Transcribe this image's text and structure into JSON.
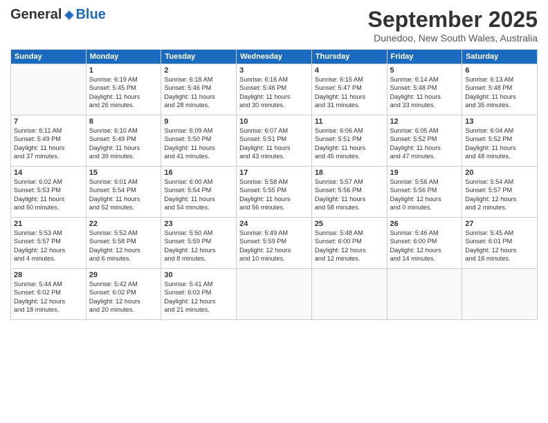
{
  "logo": {
    "general": "General",
    "blue": "Blue"
  },
  "header": {
    "month": "September 2025",
    "location": "Dunedoo, New South Wales, Australia"
  },
  "weekdays": [
    "Sunday",
    "Monday",
    "Tuesday",
    "Wednesday",
    "Thursday",
    "Friday",
    "Saturday"
  ],
  "weeks": [
    [
      {
        "day": "",
        "info": ""
      },
      {
        "day": "1",
        "info": "Sunrise: 6:19 AM\nSunset: 5:45 PM\nDaylight: 11 hours\nand 26 minutes."
      },
      {
        "day": "2",
        "info": "Sunrise: 6:18 AM\nSunset: 5:46 PM\nDaylight: 11 hours\nand 28 minutes."
      },
      {
        "day": "3",
        "info": "Sunrise: 6:16 AM\nSunset: 5:46 PM\nDaylight: 11 hours\nand 30 minutes."
      },
      {
        "day": "4",
        "info": "Sunrise: 6:15 AM\nSunset: 5:47 PM\nDaylight: 11 hours\nand 31 minutes."
      },
      {
        "day": "5",
        "info": "Sunrise: 6:14 AM\nSunset: 5:48 PM\nDaylight: 11 hours\nand 33 minutes."
      },
      {
        "day": "6",
        "info": "Sunrise: 6:13 AM\nSunset: 5:48 PM\nDaylight: 11 hours\nand 35 minutes."
      }
    ],
    [
      {
        "day": "7",
        "info": "Sunrise: 6:11 AM\nSunset: 5:49 PM\nDaylight: 11 hours\nand 37 minutes."
      },
      {
        "day": "8",
        "info": "Sunrise: 6:10 AM\nSunset: 5:49 PM\nDaylight: 11 hours\nand 39 minutes."
      },
      {
        "day": "9",
        "info": "Sunrise: 6:09 AM\nSunset: 5:50 PM\nDaylight: 11 hours\nand 41 minutes."
      },
      {
        "day": "10",
        "info": "Sunrise: 6:07 AM\nSunset: 5:51 PM\nDaylight: 11 hours\nand 43 minutes."
      },
      {
        "day": "11",
        "info": "Sunrise: 6:06 AM\nSunset: 5:51 PM\nDaylight: 11 hours\nand 45 minutes."
      },
      {
        "day": "12",
        "info": "Sunrise: 6:05 AM\nSunset: 5:52 PM\nDaylight: 11 hours\nand 47 minutes."
      },
      {
        "day": "13",
        "info": "Sunrise: 6:04 AM\nSunset: 5:52 PM\nDaylight: 11 hours\nand 48 minutes."
      }
    ],
    [
      {
        "day": "14",
        "info": "Sunrise: 6:02 AM\nSunset: 5:53 PM\nDaylight: 11 hours\nand 50 minutes."
      },
      {
        "day": "15",
        "info": "Sunrise: 6:01 AM\nSunset: 5:54 PM\nDaylight: 11 hours\nand 52 minutes."
      },
      {
        "day": "16",
        "info": "Sunrise: 6:00 AM\nSunset: 5:54 PM\nDaylight: 11 hours\nand 54 minutes."
      },
      {
        "day": "17",
        "info": "Sunrise: 5:58 AM\nSunset: 5:55 PM\nDaylight: 11 hours\nand 56 minutes."
      },
      {
        "day": "18",
        "info": "Sunrise: 5:57 AM\nSunset: 5:56 PM\nDaylight: 11 hours\nand 58 minutes."
      },
      {
        "day": "19",
        "info": "Sunrise: 5:56 AM\nSunset: 5:56 PM\nDaylight: 12 hours\nand 0 minutes."
      },
      {
        "day": "20",
        "info": "Sunrise: 5:54 AM\nSunset: 5:57 PM\nDaylight: 12 hours\nand 2 minutes."
      }
    ],
    [
      {
        "day": "21",
        "info": "Sunrise: 5:53 AM\nSunset: 5:57 PM\nDaylight: 12 hours\nand 4 minutes."
      },
      {
        "day": "22",
        "info": "Sunrise: 5:52 AM\nSunset: 5:58 PM\nDaylight: 12 hours\nand 6 minutes."
      },
      {
        "day": "23",
        "info": "Sunrise: 5:50 AM\nSunset: 5:59 PM\nDaylight: 12 hours\nand 8 minutes."
      },
      {
        "day": "24",
        "info": "Sunrise: 5:49 AM\nSunset: 5:59 PM\nDaylight: 12 hours\nand 10 minutes."
      },
      {
        "day": "25",
        "info": "Sunrise: 5:48 AM\nSunset: 6:00 PM\nDaylight: 12 hours\nand 12 minutes."
      },
      {
        "day": "26",
        "info": "Sunrise: 5:46 AM\nSunset: 6:00 PM\nDaylight: 12 hours\nand 14 minutes."
      },
      {
        "day": "27",
        "info": "Sunrise: 5:45 AM\nSunset: 6:01 PM\nDaylight: 12 hours\nand 16 minutes."
      }
    ],
    [
      {
        "day": "28",
        "info": "Sunrise: 5:44 AM\nSunset: 6:02 PM\nDaylight: 12 hours\nand 18 minutes."
      },
      {
        "day": "29",
        "info": "Sunrise: 5:42 AM\nSunset: 6:02 PM\nDaylight: 12 hours\nand 20 minutes."
      },
      {
        "day": "30",
        "info": "Sunrise: 5:41 AM\nSunset: 6:03 PM\nDaylight: 12 hours\nand 21 minutes."
      },
      {
        "day": "",
        "info": ""
      },
      {
        "day": "",
        "info": ""
      },
      {
        "day": "",
        "info": ""
      },
      {
        "day": "",
        "info": ""
      }
    ]
  ]
}
